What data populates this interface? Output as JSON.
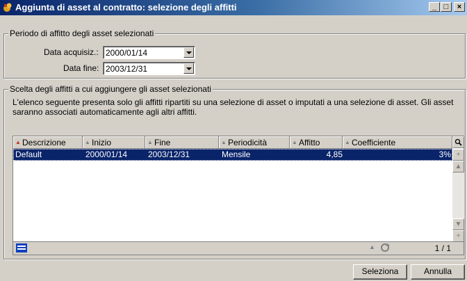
{
  "window": {
    "title": "Aggiunta di asset al contratto: selezione degli affitti",
    "minimize": "_",
    "maximize": "□",
    "close": "×"
  },
  "period": {
    "legend": "Periodo di affitto degli asset selezionati",
    "acq_label": "Data acquisiz.:",
    "acq_value": "2000/01/14",
    "end_label": "Data fine:",
    "end_value": "2003/12/31"
  },
  "selection": {
    "legend": "Scelta degli affitti a cui aggiungere gli asset selezionati",
    "description": "L'elenco seguente presenta solo gli affitti ripartiti su una selezione di asset o imputati a una selezione di asset. Gli asset saranno associati automaticamente agli altri affitti."
  },
  "table": {
    "columns": [
      "Descrizione",
      "Inizio",
      "Fine",
      "Periodicità",
      "Affitto",
      "Coefficiente"
    ],
    "rows": [
      [
        "Default",
        "2000/01/14",
        "2003/12/31",
        "Mensile",
        "4,85",
        "3%"
      ]
    ],
    "pager": "1 / 1"
  },
  "buttons": {
    "select": "Seleziona",
    "cancel": "Annulla"
  }
}
